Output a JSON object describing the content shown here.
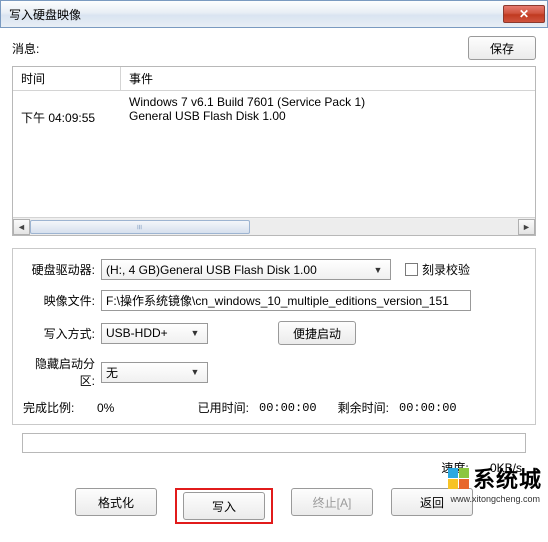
{
  "window": {
    "title": "写入硬盘映像"
  },
  "toolbar": {
    "msg_label": "消息:",
    "save_label": "保存"
  },
  "msgHeader": {
    "time": "时间",
    "event": "事件"
  },
  "messages": [
    {
      "time": "",
      "event": "Windows 7 v6.1 Build 7601 (Service Pack 1)"
    },
    {
      "time": "下午 04:09:55",
      "event": "General USB Flash Disk  1.00"
    }
  ],
  "form": {
    "drive_label": "硬盘驱动器:",
    "drive_value": "(H:, 4 GB)General USB Flash Disk  1.00",
    "verify_label": "刻录校验",
    "image_label": "映像文件:",
    "image_value": "F:\\操作系统镜像\\cn_windows_10_multiple_editions_version_151",
    "method_label": "写入方式:",
    "method_value": "USB-HDD+",
    "shortcut_label": "便捷启动",
    "hide_label": "隐藏启动分区:",
    "hide_value": "无"
  },
  "progress": {
    "done_label": "完成比例:",
    "done_value": "0%",
    "elapsed_label": "已用时间:",
    "elapsed_value": "00:00:00",
    "remain_label": "剩余时间:",
    "remain_value": "00:00:00",
    "speed_label": "速度:",
    "speed_value": "0KB/s"
  },
  "buttons": {
    "format": "格式化",
    "write": "写入",
    "abort": "终止[A]",
    "back": "返回"
  },
  "watermark": {
    "brand": "系统城",
    "url": "www.xitongcheng.com"
  },
  "colors": {
    "wm1": "#2aa8e0",
    "wm2": "#8cc63f",
    "wm3": "#f7c325",
    "wm4": "#e8672c"
  }
}
